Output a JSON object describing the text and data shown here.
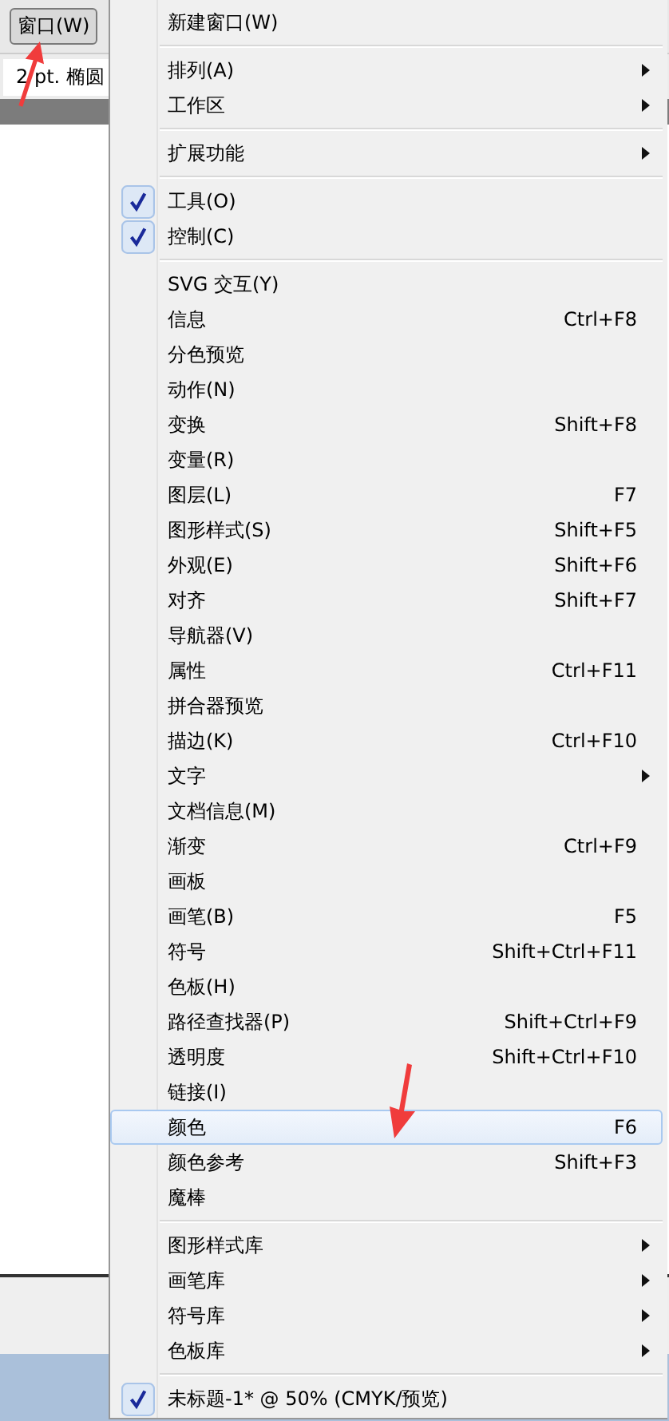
{
  "toolbar": {
    "menu_button": "窗口(W)",
    "field_value": "2 pt. 椭圆"
  },
  "menu": {
    "groups": [
      [
        {
          "label": "新建窗口(W)",
          "submenu": false,
          "checked": false,
          "selected": false
        }
      ],
      [
        {
          "label": "排列(A)",
          "submenu": true,
          "checked": false,
          "selected": false
        },
        {
          "label": "工作区",
          "submenu": true,
          "checked": false,
          "selected": false
        }
      ],
      [
        {
          "label": "扩展功能",
          "submenu": true,
          "checked": false,
          "selected": false
        }
      ],
      [
        {
          "label": "工具(O)",
          "submenu": false,
          "checked": true,
          "selected": false
        },
        {
          "label": "控制(C)",
          "submenu": false,
          "checked": true,
          "selected": false
        }
      ],
      [
        {
          "label": "SVG 交互(Y)",
          "submenu": false,
          "checked": false,
          "selected": false
        },
        {
          "label": "信息",
          "shortcut": "Ctrl+F8",
          "submenu": false,
          "checked": false,
          "selected": false
        },
        {
          "label": "分色预览",
          "submenu": false,
          "checked": false,
          "selected": false
        },
        {
          "label": "动作(N)",
          "submenu": false,
          "checked": false,
          "selected": false
        },
        {
          "label": "变换",
          "shortcut": "Shift+F8",
          "submenu": false,
          "checked": false,
          "selected": false
        },
        {
          "label": "变量(R)",
          "submenu": false,
          "checked": false,
          "selected": false
        },
        {
          "label": "图层(L)",
          "shortcut": "F7",
          "submenu": false,
          "checked": false,
          "selected": false
        },
        {
          "label": "图形样式(S)",
          "shortcut": "Shift+F5",
          "submenu": false,
          "checked": false,
          "selected": false
        },
        {
          "label": "外观(E)",
          "shortcut": "Shift+F6",
          "submenu": false,
          "checked": false,
          "selected": false
        },
        {
          "label": "对齐",
          "shortcut": "Shift+F7",
          "submenu": false,
          "checked": false,
          "selected": false
        },
        {
          "label": "导航器(V)",
          "submenu": false,
          "checked": false,
          "selected": false
        },
        {
          "label": "属性",
          "shortcut": "Ctrl+F11",
          "submenu": false,
          "checked": false,
          "selected": false
        },
        {
          "label": "拼合器预览",
          "submenu": false,
          "checked": false,
          "selected": false
        },
        {
          "label": "描边(K)",
          "shortcut": "Ctrl+F10",
          "submenu": false,
          "checked": false,
          "selected": false
        },
        {
          "label": "文字",
          "submenu": true,
          "checked": false,
          "selected": false
        },
        {
          "label": "文档信息(M)",
          "submenu": false,
          "checked": false,
          "selected": false
        },
        {
          "label": "渐变",
          "shortcut": "Ctrl+F9",
          "submenu": false,
          "checked": false,
          "selected": false
        },
        {
          "label": "画板",
          "submenu": false,
          "checked": false,
          "selected": false
        },
        {
          "label": "画笔(B)",
          "shortcut": "F5",
          "submenu": false,
          "checked": false,
          "selected": false
        },
        {
          "label": "符号",
          "shortcut": "Shift+Ctrl+F11",
          "submenu": false,
          "checked": false,
          "selected": false
        },
        {
          "label": "色板(H)",
          "submenu": false,
          "checked": false,
          "selected": false
        },
        {
          "label": "路径查找器(P)",
          "shortcut": "Shift+Ctrl+F9",
          "submenu": false,
          "checked": false,
          "selected": false
        },
        {
          "label": "透明度",
          "shortcut": "Shift+Ctrl+F10",
          "submenu": false,
          "checked": false,
          "selected": false
        },
        {
          "label": "链接(I)",
          "submenu": false,
          "checked": false,
          "selected": false
        },
        {
          "label": "颜色",
          "shortcut": "F6",
          "submenu": false,
          "checked": false,
          "selected": true
        },
        {
          "label": "颜色参考",
          "shortcut": "Shift+F3",
          "submenu": false,
          "checked": false,
          "selected": false
        },
        {
          "label": "魔棒",
          "submenu": false,
          "checked": false,
          "selected": false
        }
      ],
      [
        {
          "label": "图形样式库",
          "submenu": true,
          "checked": false,
          "selected": false
        },
        {
          "label": "画笔库",
          "submenu": true,
          "checked": false,
          "selected": false
        },
        {
          "label": "符号库",
          "submenu": true,
          "checked": false,
          "selected": false
        },
        {
          "label": "色板库",
          "submenu": true,
          "checked": false,
          "selected": false
        }
      ],
      [
        {
          "label": "未标题-1* @ 50% (CMYK/预览)",
          "submenu": false,
          "checked": true,
          "selected": false
        }
      ]
    ]
  }
}
